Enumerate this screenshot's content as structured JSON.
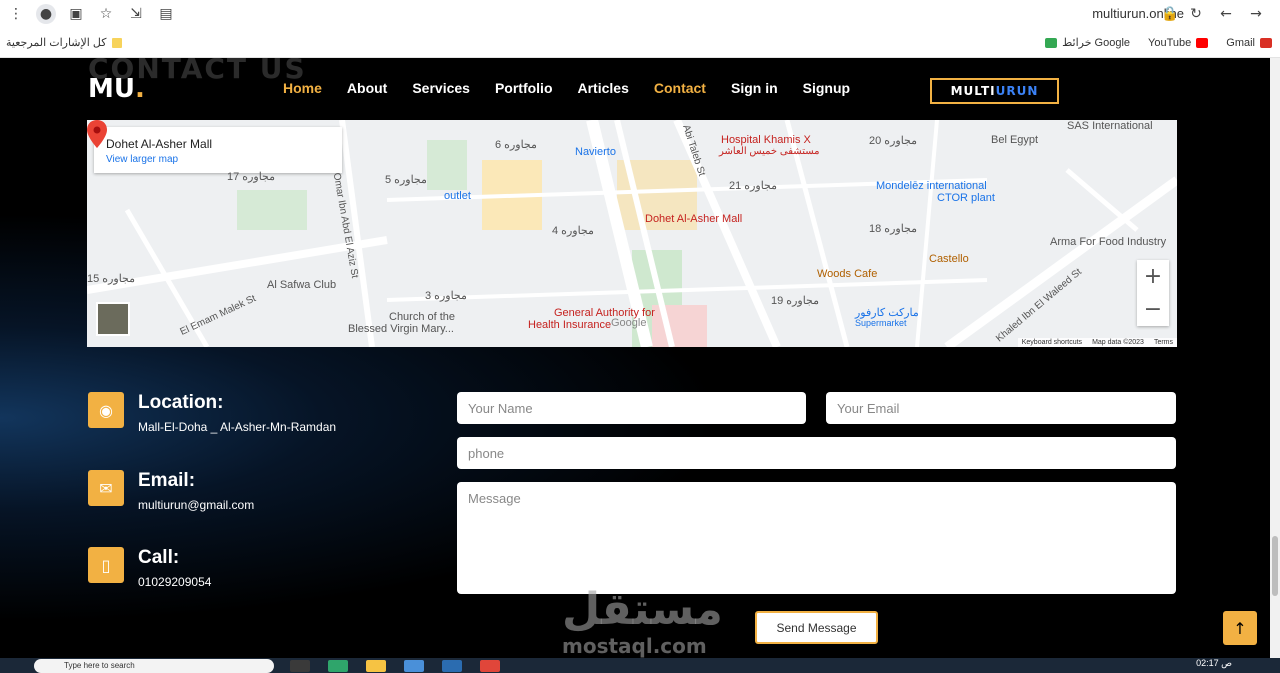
{
  "browser": {
    "url": "multiurun.online",
    "bookmarks_left": "كل الإشارات المرجعية",
    "bookmarks_right": [
      {
        "label": "Gmail",
        "icon": "gmail-icon",
        "color": "#d93025"
      },
      {
        "label": "YouTube",
        "icon": "youtube-icon",
        "color": "#ff0000"
      },
      {
        "label": "خرائط Google",
        "icon": "maps-icon",
        "color": "#34a853"
      }
    ]
  },
  "header": {
    "ghost_text": "CONTACT US",
    "logo": "MU",
    "logo_dot": ".",
    "nav": [
      {
        "label": "Home",
        "active": true
      },
      {
        "label": "About",
        "active": false
      },
      {
        "label": "Services",
        "active": false
      },
      {
        "label": "Portfolio",
        "active": false
      },
      {
        "label": "Articles",
        "active": false
      },
      {
        "label": "Contact",
        "active": true
      },
      {
        "label": "Sign in",
        "active": false
      },
      {
        "label": "Signup",
        "active": false
      }
    ],
    "brand_prefix": "MULTI",
    "brand_suffix": "URUN"
  },
  "map": {
    "place_title": "Dohet Al-Asher Mall",
    "larger_map_link": "View larger map",
    "pin_label": "Dohet Al-Asher Mall",
    "labels": [
      {
        "text": "Hospital Khamis X",
        "cls": "red"
      },
      {
        "text": "مستشفى خميس العاشر",
        "cls": "red"
      },
      {
        "text": "Navierto",
        "cls": "blue"
      },
      {
        "text": "outlet",
        "cls": "blue"
      },
      {
        "text": "Bel Egypt",
        "cls": ""
      },
      {
        "text": "SAS International",
        "cls": ""
      },
      {
        "text": "Mondelēz international",
        "cls": "blue"
      },
      {
        "text": "CTOR plant",
        "cls": "blue"
      },
      {
        "text": "Arma For Food Industry",
        "cls": ""
      },
      {
        "text": "Woods Cafe",
        "cls": "orange"
      },
      {
        "text": "Castello",
        "cls": "orange"
      },
      {
        "text": "Al Safwa Club",
        "cls": ""
      },
      {
        "text": "Church of the",
        "cls": ""
      },
      {
        "text": "Blessed Virgin Mary...",
        "cls": ""
      },
      {
        "text": "General Authority for",
        "cls": "red"
      },
      {
        "text": "Health Insurance",
        "cls": "red"
      },
      {
        "text": "ماركت كارفور",
        "cls": "blue"
      },
      {
        "text": "Supermarket",
        "cls": "blue"
      },
      {
        "text": "El Emam Malek St",
        "cls": ""
      },
      {
        "text": "Omar Ibn Abd El Aziz St",
        "cls": ""
      },
      {
        "text": "Abi Taleb St",
        "cls": ""
      },
      {
        "text": "Khaled Ibn El Waleed St",
        "cls": ""
      },
      {
        "text": "مجاوره 5",
        "cls": ""
      },
      {
        "text": "مجاوره 4",
        "cls": ""
      },
      {
        "text": "مجاوره 3",
        "cls": ""
      },
      {
        "text": "مجاوره 6",
        "cls": ""
      },
      {
        "text": "مجاوره 17",
        "cls": ""
      },
      {
        "text": "مجاوره 20",
        "cls": ""
      },
      {
        "text": "مجاوره 21",
        "cls": ""
      },
      {
        "text": "مجاوره 18",
        "cls": ""
      },
      {
        "text": "مجاوره 19",
        "cls": ""
      },
      {
        "text": "مجاوره 15",
        "cls": ""
      },
      {
        "text": "Google",
        "cls": ""
      }
    ],
    "zoom_in": "+",
    "zoom_out": "−",
    "footer": [
      "Keyboard shortcuts",
      "Map data ©2023",
      "Terms"
    ]
  },
  "contact": {
    "items": [
      {
        "title": "Location:",
        "text": "Mall-El-Doha _ Al-Asher-Mn-Ramdan",
        "icon": "location-pin-icon"
      },
      {
        "title": "Email:",
        "text": "multiurun@gmail.com",
        "icon": "envelope-icon"
      },
      {
        "title": "Call:",
        "text": "01029209054",
        "icon": "phone-icon"
      }
    ]
  },
  "form": {
    "name_placeholder": "Your Name",
    "email_placeholder": "Your Email",
    "phone_placeholder": "phone",
    "message_placeholder": "Message",
    "send_label": "Send Message"
  },
  "watermark": {
    "ar": "مستقل",
    "en": "mostaql.com"
  },
  "taskbar": {
    "search_text": "Type here to search",
    "time": "02:17",
    "ampm": "ص"
  },
  "colors": {
    "accent": "#f2b143",
    "brand_blue": "#3b82f6"
  }
}
